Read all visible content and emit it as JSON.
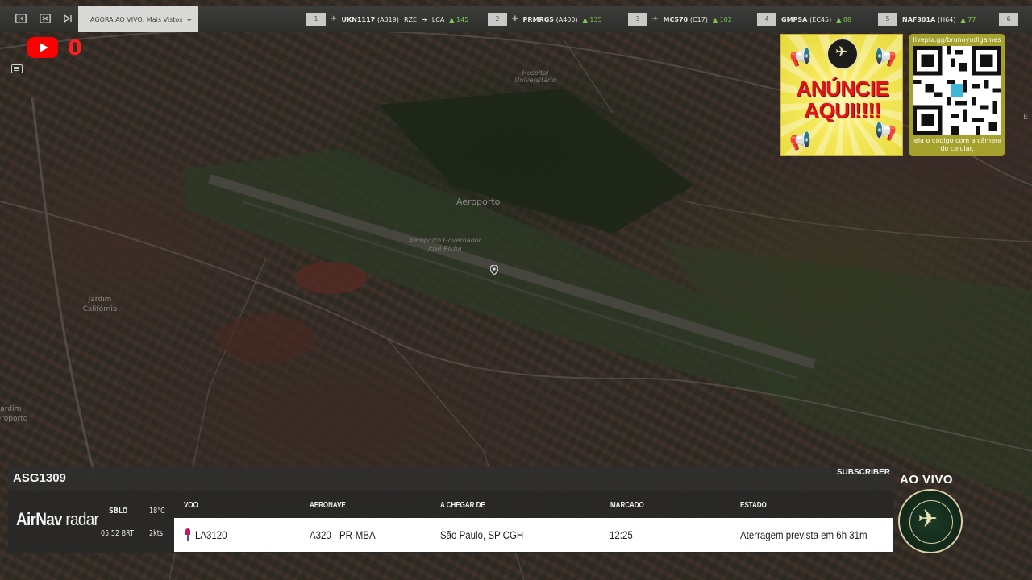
{
  "topbar": {
    "now_live_label": "AGORA AO VIVO: Mais Vistos",
    "flights": [
      {
        "rank": "1",
        "callsign": "UKN1117",
        "aircraft": "(A319)",
        "from": "RZE",
        "to": "LCA",
        "viewers": "145"
      },
      {
        "rank": "2",
        "callsign": "PRMRG5",
        "aircraft": "(A400)",
        "from": "",
        "to": "",
        "viewers": "135"
      },
      {
        "rank": "3",
        "callsign": "MC570",
        "aircraft": "(C17)",
        "from": "",
        "to": "",
        "viewers": "102"
      },
      {
        "rank": "4",
        "callsign": "GMPSA",
        "aircraft": "(EC45)",
        "from": "",
        "to": "",
        "viewers": "88"
      },
      {
        "rank": "5",
        "callsign": "NAF301A",
        "aircraft": "(H64)",
        "from": "",
        "to": "",
        "viewers": "77"
      },
      {
        "rank": "6",
        "callsign": "",
        "aircraft": "",
        "from": "",
        "to": "",
        "viewers": ""
      }
    ]
  },
  "social": {
    "youtube_icon": "youtube-icon",
    "count": "0"
  },
  "ad": {
    "headline": "ANÚNCIE AQUI!!!!"
  },
  "qr": {
    "url": "livepix.gg/brunoyudigames",
    "caption": "leia o código com a câmera do celular."
  },
  "map_labels": {
    "airport": "Aeroporto",
    "airport_full": "Aeroporto Governador José Richa",
    "hospital": "Hospital Universitário",
    "district": "Jardim Califórnia",
    "east_edge": "E",
    "west_edge": "Jardim Aeroporto"
  },
  "panel": {
    "callsign": "ASG1309",
    "subscriber": "SUBSCRIBER",
    "brand_air": "AirNav",
    "brand_radar": "radar",
    "airport_code": "SBLO",
    "temperature": "18°C",
    "local_time": "05:52 BRT",
    "wind": "2kts",
    "columns": {
      "flight": "VOO",
      "aircraft": "AERONAVE",
      "origin": "A CHEGAR DE",
      "scheduled": "MARCADO",
      "status": "ESTADO"
    },
    "row": {
      "flight": "LA3120",
      "aircraft": "A320 - PR-MBA",
      "origin": "São Paulo, SP CGH",
      "scheduled": "12:25",
      "status": "Aterragem prevista em 6h 31m"
    }
  },
  "live_label": "AO VIVO",
  "colors": {
    "viewer_green": "#7cc84e",
    "youtube_red": "#ff0000",
    "ad_text_red": "#e2141b",
    "ad_yellow": "#f4e85a"
  }
}
